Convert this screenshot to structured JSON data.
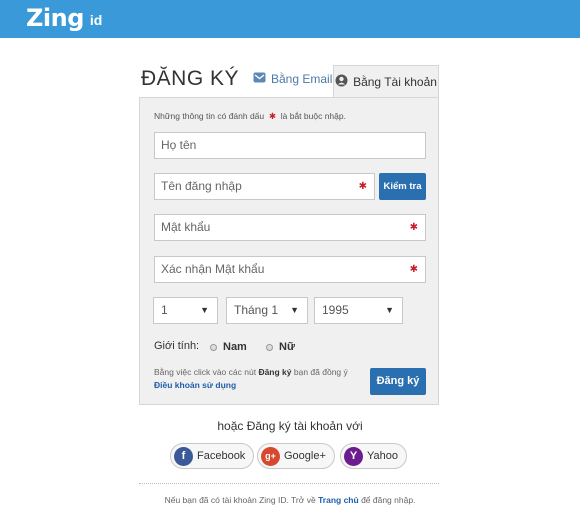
{
  "header": {
    "logo_text": "Zing",
    "logo_suffix": "id",
    "brand_color": "#3a9ad9"
  },
  "title": "ĐĂNG KÝ",
  "tabs": [
    {
      "label": "Bằng Email",
      "icon": "envelope-icon",
      "active": false
    },
    {
      "label": "Bằng Tài khoản",
      "icon": "user-icon",
      "active": true
    }
  ],
  "form": {
    "note_prefix": "Những thông tin có đánh dấu",
    "note_suffix": "là bắt buộc nhập.",
    "fullname_placeholder": "Họ tên",
    "username_placeholder": "Tên đăng nhập",
    "check_button": "Kiểm tra",
    "password_placeholder": "Mật khẩu",
    "confirm_placeholder": "Xác nhận Mật khẩu",
    "day": "1",
    "month": "Tháng 1",
    "year": "1995",
    "gender_label": "Giới tính:",
    "gender_male": "Nam",
    "gender_female": "Nữ",
    "terms_text_1": "Bằng việc click vào các nút",
    "terms_bold": "Đăng ký",
    "terms_text_2": "bạn đã đồng ý",
    "terms_link": "Điều khoản sử dụng",
    "register_button": "Đăng ký",
    "accent_color": "#2a6fb0",
    "required_color": "#c81e2a"
  },
  "social": {
    "heading": "hoặc Đăng ký tài khoản với",
    "facebook": "Facebook",
    "google": "Google+",
    "yahoo": "Yahoo"
  },
  "footer": {
    "text_1": "Nếu bạn đã có tài khoản Zing ID. Trở về",
    "link": "Trang chủ",
    "text_2": "để đăng nhập."
  }
}
